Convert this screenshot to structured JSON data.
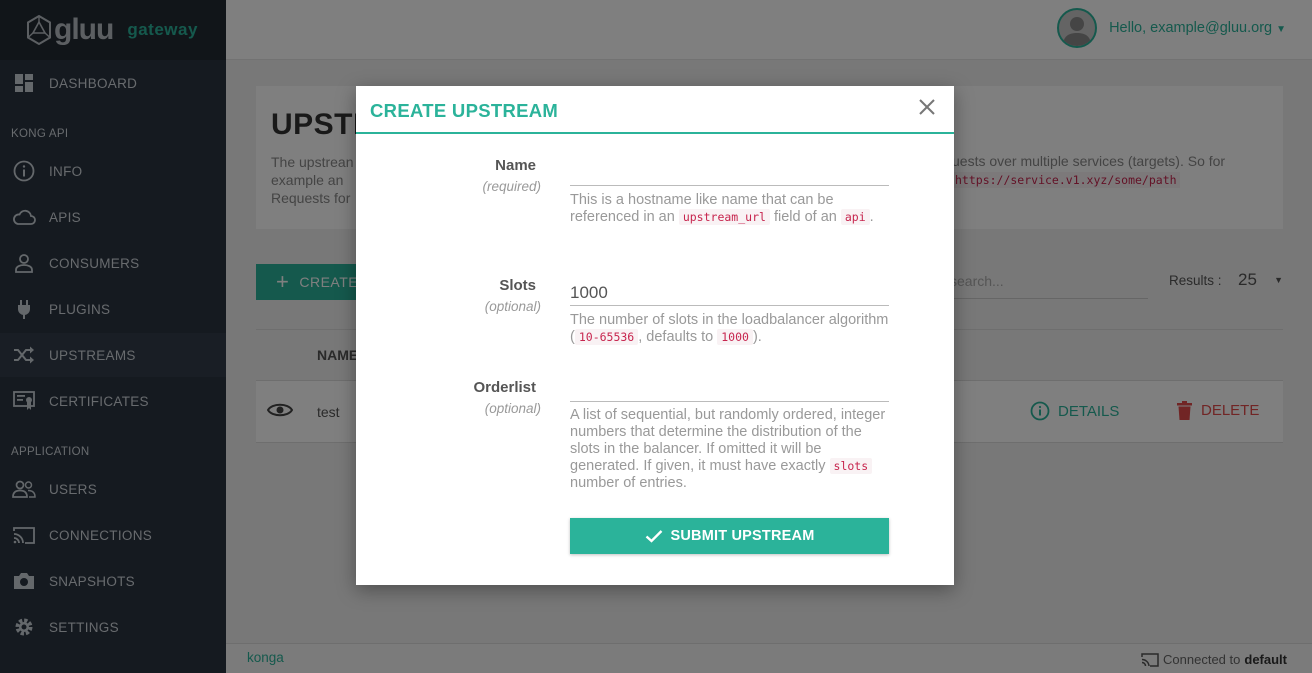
{
  "brand": {
    "name": "gluu",
    "sub": "gateway"
  },
  "sidebar": {
    "items": [
      {
        "label": "DASHBOARD",
        "icon": "dashboard-icon"
      },
      {
        "label": "INFO",
        "icon": "info-icon"
      },
      {
        "label": "APIS",
        "icon": "cloud-icon"
      },
      {
        "label": "CONSUMERS",
        "icon": "user-icon"
      },
      {
        "label": "PLUGINS",
        "icon": "plug-icon"
      },
      {
        "label": "UPSTREAMS",
        "icon": "shuffle-icon"
      },
      {
        "label": "CERTIFICATES",
        "icon": "certificate-icon"
      },
      {
        "label": "USERS",
        "icon": "users-icon"
      },
      {
        "label": "CONNECTIONS",
        "icon": "cast-icon"
      },
      {
        "label": "SNAPSHOTS",
        "icon": "camera-icon"
      },
      {
        "label": "SETTINGS",
        "icon": "gear-icon"
      }
    ],
    "sections": [
      "KONG API",
      "APPLICATION"
    ]
  },
  "header": {
    "greeting": "Hello, example@gluu.org"
  },
  "page": {
    "title": "UPSTR",
    "desc_line1": "The upstrean",
    "desc_line2": "example an",
    "desc_line3": "Requests for",
    "desc_right": "uests over multiple services (targets). So for",
    "code_right": "https://service.v1.xyz/some/path",
    "create_label": "CREATE",
    "search_placeholder": "search...",
    "results_label": "Results :",
    "results_value": "25",
    "col_name": "NAME",
    "row_name": "test",
    "details_label": "DETAILS",
    "delete_label": "DELETE"
  },
  "footer": {
    "app": "konga",
    "connected_prefix": "Connected to",
    "connection": "default"
  },
  "modal": {
    "title": "CREATE UPSTREAM",
    "name": {
      "label": "Name",
      "hint": "(required)",
      "value": "",
      "help_a": "This is a hostname like name that can be referenced in an",
      "help_code1": "upstream_url",
      "help_b": "field of an",
      "help_code2": "api",
      "help_c": "."
    },
    "slots": {
      "label": "Slots",
      "hint": "(optional)",
      "value": "1000",
      "help_a": "The number of slots in the loadbalancer algorithm (",
      "help_code1": "10-65536",
      "help_b": ", defaults to",
      "help_code2": "1000",
      "help_c": ")."
    },
    "orderlist": {
      "label": "Orderlist",
      "hint": "(optional)",
      "value": "",
      "help_a": "A list of sequential, but randomly ordered, integer numbers that determine the distribution of the slots in the balancer. If omitted it will be generated. If given, it must have exactly",
      "help_code1": "slots",
      "help_b": "number of entries."
    },
    "submit_label": "SUBMIT UPSTREAM"
  },
  "colors": {
    "accent": "#2bb39a",
    "sidebar": "#2a3440",
    "danger": "#e24b4b"
  }
}
